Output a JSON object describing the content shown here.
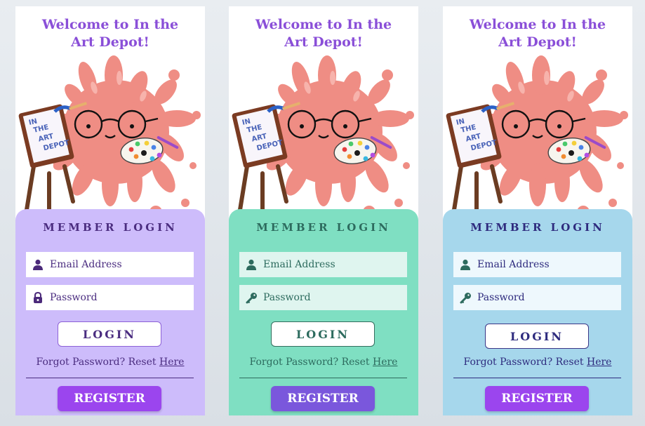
{
  "cards": [
    {
      "title": "Welcome to In the Art Depot!",
      "panel_title": "MEMBER LOGIN",
      "email_placeholder": "Email Address",
      "password_placeholder": "Password",
      "login_label": "LOGIN",
      "forgot_text": "Forgot Password? Reset",
      "forgot_link": "Here",
      "register_label": "REGISTER",
      "email_icon": "user-icon",
      "password_icon": "lock-icon",
      "colors": {
        "panel": "#cdbcfb",
        "field": "#ffffff",
        "text": "#4b2d80",
        "icon": "#4b2a7a",
        "register": "#9b45ee",
        "login_border": "#8d61d6"
      }
    },
    {
      "title": "Welcome to In the Art Depot!",
      "panel_title": "MEMBER LOGIN",
      "email_placeholder": "Email Address",
      "password_placeholder": "Password",
      "login_label": "LOGIN",
      "forgot_text": "Forgot Password? Reset",
      "forgot_link": "Here",
      "register_label": "REGISTER",
      "email_icon": "user-icon",
      "password_icon": "key-icon",
      "colors": {
        "panel": "#7fdfc2",
        "field": "#dff5ef",
        "text": "#2d6b5e",
        "icon": "#2d6b5e",
        "register": "#7a57dc",
        "login_border": "#336d5e"
      }
    },
    {
      "title": "Welcome to In the Art Depot!",
      "panel_title": "MEMBER LOGIN",
      "email_placeholder": "Email Address",
      "password_placeholder": "Password",
      "login_label": "LOGIN",
      "forgot_text": "Forgot Password? Reset",
      "forgot_link": "Here",
      "register_label": "REGISTER",
      "email_icon": "user-icon",
      "password_icon": "key-icon",
      "colors": {
        "panel": "#a6d7ec",
        "field": "#eef8fd",
        "text": "#2e2b7e",
        "icon": "#2d6b5e",
        "register": "#9b45ee",
        "login_border": "#3a3686"
      }
    }
  ],
  "logo_text": "IN THE ART DEPOT"
}
